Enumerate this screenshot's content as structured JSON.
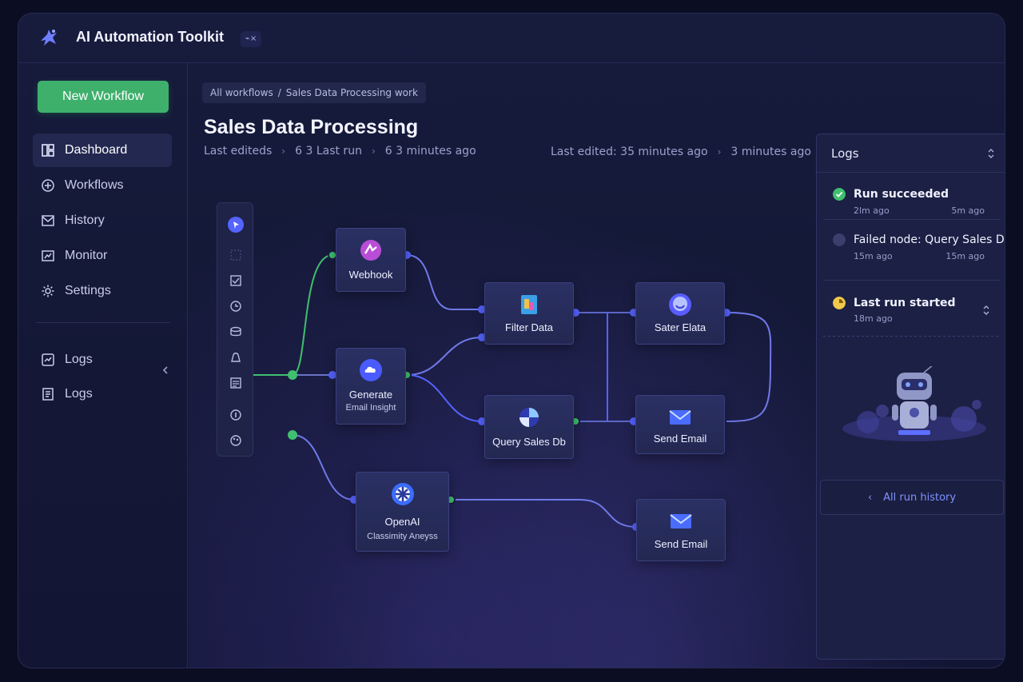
{
  "app": {
    "title": "AI Automation Toolkit",
    "badge": "⌁×"
  },
  "sidebar": {
    "new_workflow": "New Workflow",
    "items": [
      {
        "label": "Dashboard",
        "icon": "dashboard-icon",
        "active": true
      },
      {
        "label": "Workflows",
        "icon": "plus-circle-icon"
      },
      {
        "label": "History",
        "icon": "mail-icon"
      },
      {
        "label": "Monitor",
        "icon": "monitor-icon"
      },
      {
        "label": "Settings",
        "icon": "gear-icon"
      },
      {
        "label": "Logs",
        "icon": "logs-icon"
      },
      {
        "label": "Logs",
        "icon": "document-icon"
      }
    ]
  },
  "breadcrumb": {
    "root": "All workflows",
    "sep": "/",
    "current": "Sales Data Processing work"
  },
  "page": {
    "title": "Sales Data Processing",
    "meta_left": [
      "Last editeds",
      "6 3 Last run",
      "6 3 minutes ago"
    ],
    "meta_right": [
      "Last edited: 35 minutes ago",
      "3 minutes ago"
    ]
  },
  "nodes": {
    "webhook": {
      "label": "Webhook"
    },
    "generate": {
      "label": "Generate",
      "sub": "Email Insight"
    },
    "filter": {
      "label": "Filter Data"
    },
    "query": {
      "label": "Query Sales Db"
    },
    "sater": {
      "label": "Sater Elata"
    },
    "send1": {
      "label": "Send Email"
    },
    "openai": {
      "label": "OpenAI",
      "sub": "Classimity Aneyss"
    },
    "send2": {
      "label": "Send Email"
    }
  },
  "logs": {
    "title": "Logs",
    "entries": [
      {
        "title": "Run succeeded",
        "time_left": "2lm ago",
        "time_right": "5m ago",
        "status": "success"
      },
      {
        "title": "Failed node: Query Sales DB",
        "time_left": "15m ago",
        "time_right": "15m ago",
        "status": "failed"
      },
      {
        "title": "Last run started",
        "time_left": "18m ago",
        "status": "running"
      }
    ],
    "history_chev": "‹",
    "history": "All run history"
  },
  "colors": {
    "accent_green": "#3eb06c",
    "accent_blue": "#5563ff",
    "wire_blue": "#6f79e8",
    "wire_green": "#3fbf6f",
    "link": "#7f93ff"
  }
}
